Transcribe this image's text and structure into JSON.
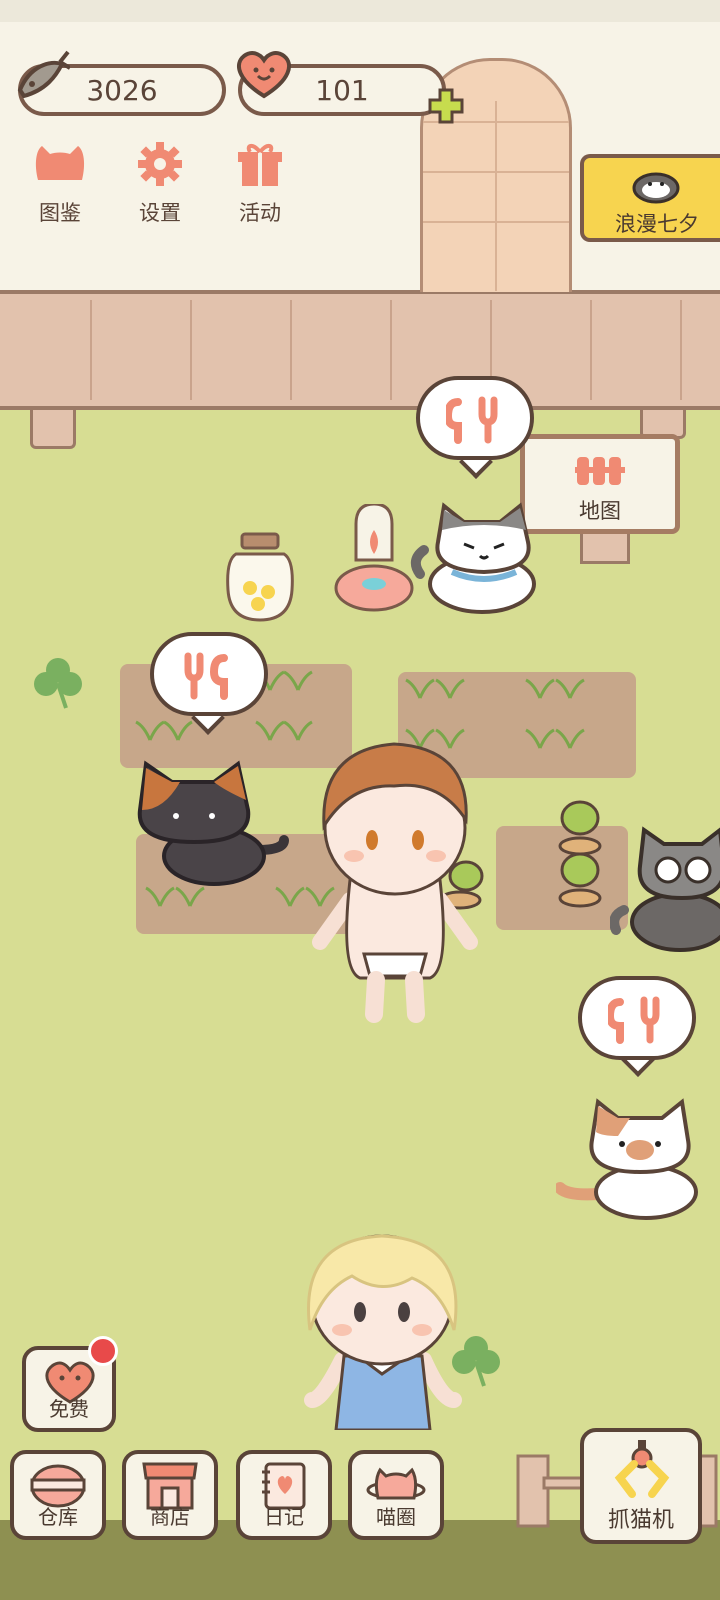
{
  "resources": {
    "fish": "3026",
    "hearts": "101"
  },
  "top_menu": [
    {
      "label": "图鉴",
      "icon": "cat-face-icon"
    },
    {
      "label": "设置",
      "icon": "gear-icon"
    },
    {
      "label": "活动",
      "icon": "gift-icon"
    }
  ],
  "event_banner": {
    "label": "浪漫七夕"
  },
  "sign": {
    "label": "地图"
  },
  "free_button": {
    "label": "免费"
  },
  "bottom_nav": [
    {
      "label": "仓库"
    },
    {
      "label": "商店"
    },
    {
      "label": "日记"
    },
    {
      "label": "喵圈"
    }
  ],
  "claw_machine": {
    "label": "抓猫机"
  },
  "colors": {
    "accent": "#f08a73",
    "border": "#5a4438",
    "grass": "#d7dd93",
    "banner": "#f7d44f",
    "badge": "#e84a4a"
  }
}
